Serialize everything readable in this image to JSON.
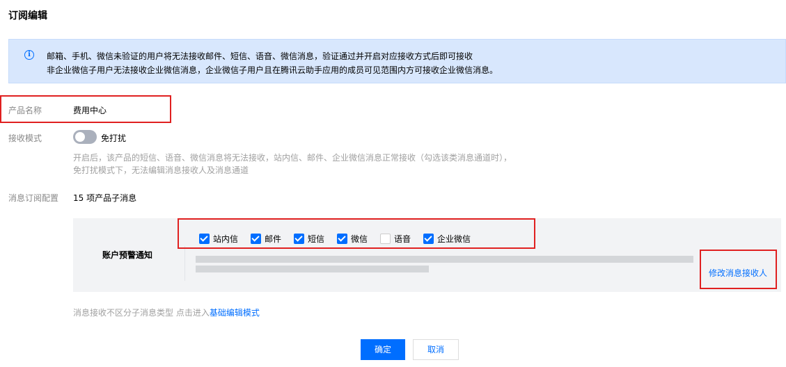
{
  "page": {
    "title": "订阅编辑"
  },
  "notice": {
    "line1": "邮箱、手机、微信未验证的用户将无法接收邮件、短信、语音、微信消息，验证通过并开启对应接收方式后即可接收",
    "line2": "非企业微信子用户无法接收企业微信消息，企业微信子用户且在腾讯云助手应用的成员可见范围内方可接收企业微信消息。"
  },
  "product": {
    "label": "产品名称",
    "value": "费用中心"
  },
  "mode": {
    "label": "接收模式",
    "toggle_label": "免打扰",
    "toggle_on": false,
    "hint1": "开启后，该产品的短信、语音、微信消息将无法接收，站内信、邮件、企业微信消息正常接收（勾选该类消息通道时），",
    "hint2": "免打扰模式下，无法编辑消息接收人及消息通道"
  },
  "subscription": {
    "label": "消息订阅配置",
    "value": "15 项产品子消息",
    "row_title": "账户预警通知",
    "channels": [
      {
        "label": "站内信",
        "checked": true
      },
      {
        "label": "邮件",
        "checked": true
      },
      {
        "label": "短信",
        "checked": true
      },
      {
        "label": "微信",
        "checked": true
      },
      {
        "label": "语音",
        "checked": false
      },
      {
        "label": "企业微信",
        "checked": true
      }
    ],
    "edit_recipients": "修改消息接收人"
  },
  "footer": {
    "hint": "消息接收不区分子消息类型 点击进入",
    "hint_link": "基础编辑模式",
    "confirm": "确定",
    "cancel": "取消"
  },
  "colors": {
    "accent": "#006eff",
    "highlight": "#e02020",
    "notice_bg": "#d8e7fd"
  }
}
